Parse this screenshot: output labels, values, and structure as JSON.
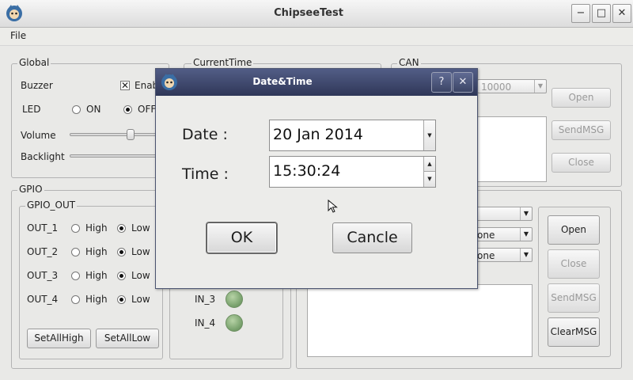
{
  "window": {
    "title": "ChipseeTest",
    "minimize": "−",
    "maximize": "□",
    "close": "✕"
  },
  "menu": {
    "file": "File"
  },
  "global": {
    "title": "Global",
    "buzzer_label": "Buzzer",
    "buzzer_check_text": "Enab",
    "led_label": "LED",
    "led_on": "ON",
    "led_off": "OFF",
    "led_selected": "OFF",
    "volume_label": "Volume",
    "volume_level_percent": 70,
    "backlight_label": "Backlight"
  },
  "current_time": {
    "title": "CurrentTime"
  },
  "can": {
    "title": "CAN",
    "bitrate": "10000",
    "open": "Open",
    "send": "SendMSG",
    "close": "Close"
  },
  "gpio": {
    "title": "GPIO",
    "out_group_title": "GPIO_OUT",
    "high_label": "High",
    "low_label": "Low",
    "outputs": [
      {
        "name": "OUT_1",
        "state": "Low"
      },
      {
        "name": "OUT_2",
        "state": "Low"
      },
      {
        "name": "OUT_3",
        "state": "Low"
      },
      {
        "name": "OUT_4",
        "state": "Low"
      }
    ],
    "set_all_high": "SetAllHigh",
    "set_all_low": "SetAllLow",
    "inputs": [
      "IN_3",
      "IN_4"
    ]
  },
  "serial": {
    "combo_2": "one",
    "combo_3": "one",
    "open": "Open",
    "close": "Close",
    "send": "SendMSG",
    "clear": "ClearMSG"
  },
  "dialog": {
    "title": "Date&Time",
    "help": "?",
    "close": "✕",
    "date_label": "Date :",
    "date_value": "20 Jan 2014",
    "time_label": "Time :",
    "time_value": "15:30:24",
    "ok": "OK",
    "cancel": "Cancle"
  },
  "colors": {
    "dialog_title": "#3f486b",
    "led_green": "#7ea672"
  }
}
